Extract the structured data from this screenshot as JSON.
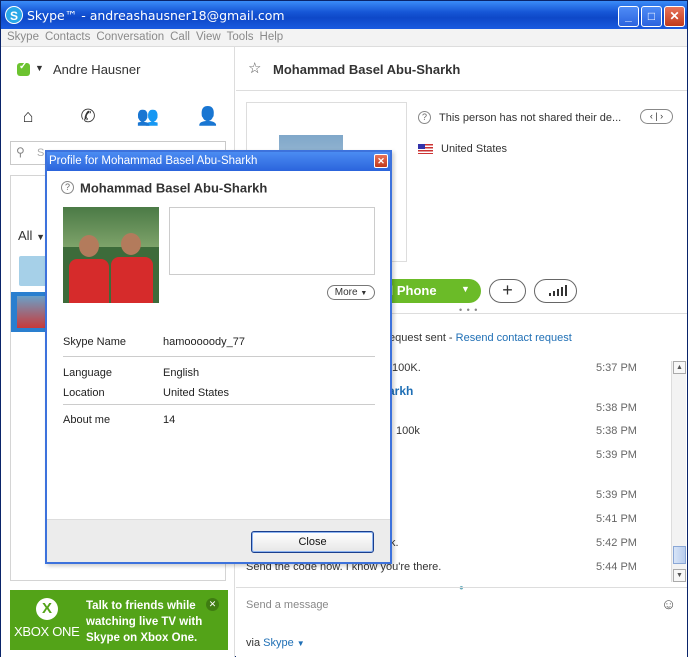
{
  "window": {
    "title": "Skype™ - andreashausner18@gmail.com",
    "app_icon": "S"
  },
  "menu": [
    "Skype",
    "Contacts",
    "Conversation",
    "Call",
    "View",
    "Tools",
    "Help"
  ],
  "sidebar": {
    "user_name": "Andre Hausner",
    "search_placeholder": "S",
    "filter_label": "All"
  },
  "ad": {
    "brand": "XBOX ONE",
    "text": "Talk to friends while watching live TV with Skype on Xbox One."
  },
  "conversation": {
    "contact_name": "Mohammad Basel Abu-Sharkh",
    "info_text": "This person has not shared their de...",
    "country": "United States",
    "call_label": "ll Phone",
    "request_text": "equest sent - ",
    "request_link": "Resend contact request",
    "messages": [
      {
        "text": "100K.",
        "time": "5:37 PM"
      },
      {
        "text": "arkh",
        "time": ""
      },
      {
        "text": "",
        "time": "5:38 PM"
      },
      {
        "text": "100k",
        "time": "5:38 PM"
      },
      {
        "text": "",
        "time": "5:39 PM"
      },
      {
        "text": "",
        "time": "5:39 PM"
      },
      {
        "text": "",
        "time": "5:41 PM"
      },
      {
        "text": "k.",
        "time": "5:42 PM"
      },
      {
        "text": "Send the code now. I know you're there.",
        "time": "5:44 PM"
      }
    ],
    "compose_placeholder": "Send a message",
    "via_label": "via ",
    "via_link": "Skype"
  },
  "dialog": {
    "title": "Profile for Mohammad Basel Abu-Sharkh",
    "name": "Mohammad Basel Abu-Sharkh",
    "more_label": "More",
    "fields": [
      {
        "label": "Skype Name",
        "value": "hamooooody_77"
      },
      {
        "label": "Language",
        "value": "English"
      },
      {
        "label": "Location",
        "value": "United States"
      },
      {
        "label": "About me",
        "value": "14"
      }
    ],
    "close_label": "Close"
  },
  "colors": {
    "accent": "#1f6fb5",
    "call_green": "#6bbb28",
    "xbox_green": "#53a318",
    "titlebar_blue": "#1656d6"
  }
}
